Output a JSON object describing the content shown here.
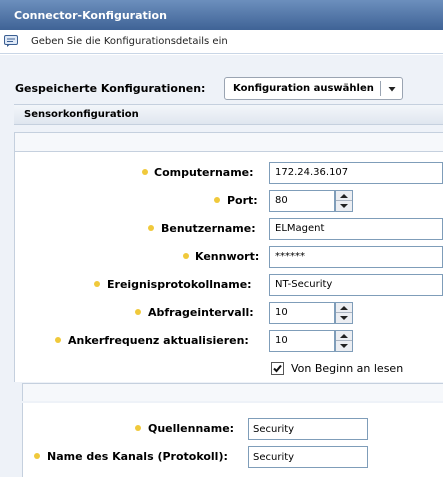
{
  "window": {
    "title": "Connector-Konfiguration"
  },
  "info": {
    "text": "Geben Sie die Konfigurationsdetails ein"
  },
  "saved_configs": {
    "label": "Gespeicherte Konfigurationen:",
    "dropdown_value": "Konfiguration auswählen"
  },
  "section": {
    "title": "Sensorkonfiguration"
  },
  "fields": {
    "computername": {
      "label": "Computername:",
      "value": "172.24.36.107"
    },
    "port": {
      "label": "Port:",
      "value": "80"
    },
    "benutzername": {
      "label": "Benutzername:",
      "value": "ELMagent"
    },
    "kennwort": {
      "label": "Kennwort:",
      "value": "******"
    },
    "ereignisprotokollname": {
      "label": "Ereignisprotokollname:",
      "value": "NT-Security"
    },
    "abfrageintervall": {
      "label": "Abfrageintervall:",
      "value": "10"
    },
    "ankerfrequenz": {
      "label": "Ankerfrequenz aktualisieren:",
      "value": "10"
    }
  },
  "checkbox": {
    "label": "Von Beginn an lesen",
    "checked": true
  },
  "lower_fields": {
    "quellenname": {
      "label": "Quellenname:",
      "value": "Security"
    },
    "kanal": {
      "label": "Name des Kanals (Protokoll):",
      "value": "Security"
    }
  },
  "colors": {
    "title_bar": "#4a6ea0",
    "required_dot": "#f0c93b",
    "input_border": "#7f9db9"
  },
  "icons": {
    "info": "message-icon",
    "dropdown": "chevron-down-icon",
    "spinner_up": "arrow-up-icon",
    "spinner_down": "arrow-down-icon",
    "check": "checkmark-icon"
  }
}
